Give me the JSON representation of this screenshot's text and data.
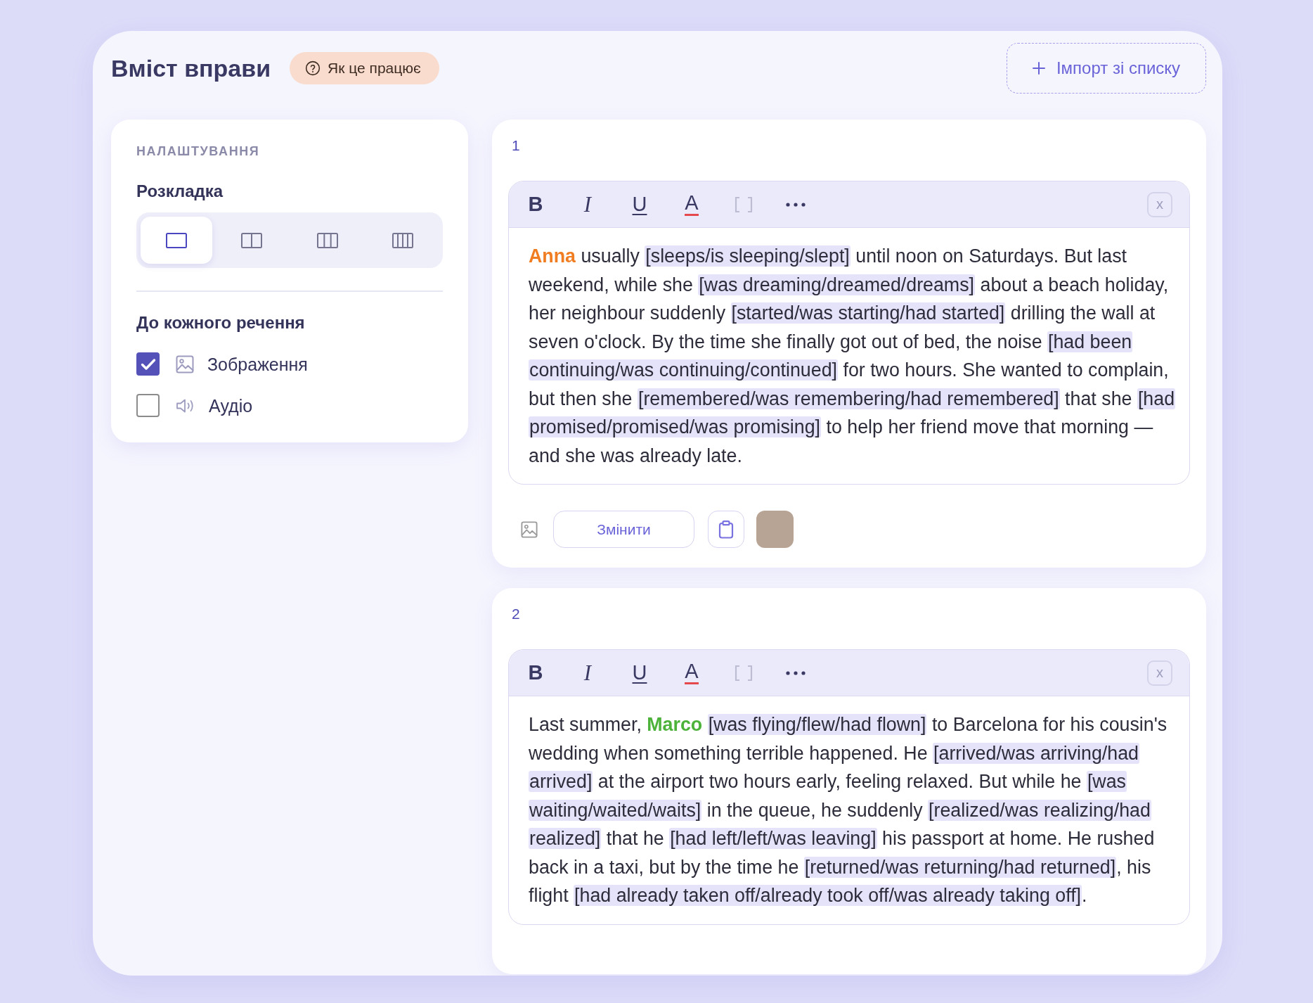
{
  "header": {
    "title": "Вміст вправи",
    "help_label": "Як це працює",
    "import_label": "Імпорт зі списку"
  },
  "settings": {
    "heading": "НАЛАШТУВАННЯ",
    "layout_label": "Розкладка",
    "layout_options": [
      {
        "kind": "one",
        "selected": true
      },
      {
        "kind": "two",
        "selected": false
      },
      {
        "kind": "three",
        "selected": false
      },
      {
        "kind": "four",
        "selected": false
      }
    ],
    "per_sentence_label": "До кожного речення",
    "attachments": [
      {
        "kind": "image",
        "label": "Зображення",
        "checked": true
      },
      {
        "kind": "audio",
        "label": "Аудіо",
        "checked": false
      }
    ]
  },
  "exercises": [
    {
      "number": "1",
      "toolbar": [
        {
          "kind": "bold",
          "label": "B",
          "disabled": false
        },
        {
          "kind": "italic",
          "label": "I",
          "disabled": false
        },
        {
          "kind": "underline",
          "label": "U",
          "disabled": false
        },
        {
          "kind": "color",
          "label": "A",
          "disabled": false
        },
        {
          "kind": "brackets",
          "disabled": true
        },
        {
          "kind": "more",
          "disabled": false
        }
      ],
      "close_label": "x",
      "text": [
        {
          "kind": "name",
          "text": "Anna",
          "color": "#f07d22"
        },
        {
          "kind": "plain",
          "text": " usually "
        },
        {
          "kind": "blank",
          "text": "[sleeps/is sleeping/slept]"
        },
        {
          "kind": "plain",
          "text": " until noon on Saturdays. But last weekend, while she "
        },
        {
          "kind": "blank",
          "text": "[was dreaming/dreamed/dreams]"
        },
        {
          "kind": "plain",
          "text": " about a beach holiday, her neighbour suddenly "
        },
        {
          "kind": "blank",
          "text": "[started/was starting/had started]"
        },
        {
          "kind": "plain",
          "text": " drilling the wall at seven o'clock. By the time she finally got out of bed, the noise "
        },
        {
          "kind": "blank",
          "text": "[had been continuing/was continuing/continued]"
        },
        {
          "kind": "plain",
          "text": " for two hours. She wanted to complain, but then she "
        },
        {
          "kind": "blank",
          "text": "[remembered/was remembering/had remembered]"
        },
        {
          "kind": "plain",
          "text": " that she "
        },
        {
          "kind": "blank",
          "text": "[had promised/promised/was promising]"
        },
        {
          "kind": "plain",
          "text": " to help her friend move that morning — and she was already late."
        }
      ],
      "media": {
        "change_label": "Змінити"
      }
    },
    {
      "number": "2",
      "toolbar": [
        {
          "kind": "bold",
          "label": "B",
          "disabled": false
        },
        {
          "kind": "italic",
          "label": "I",
          "disabled": false
        },
        {
          "kind": "underline",
          "label": "U",
          "disabled": false
        },
        {
          "kind": "color",
          "label": "A",
          "disabled": false
        },
        {
          "kind": "brackets",
          "disabled": true
        },
        {
          "kind": "more",
          "disabled": false
        }
      ],
      "close_label": "x",
      "text": [
        {
          "kind": "plain",
          "text": "Last summer, "
        },
        {
          "kind": "name",
          "text": "Marco",
          "color": "#4cb23a",
          "space_after": true
        },
        {
          "kind": "blank",
          "text": "[was flying/flew/had flown]"
        },
        {
          "kind": "plain",
          "text": " to Barcelona for his cousin's wedding when something terrible happened. He "
        },
        {
          "kind": "blank",
          "text": "[arrived/was arriving/had arrived]"
        },
        {
          "kind": "plain",
          "text": " at the airport two hours early, feeling relaxed. But while he "
        },
        {
          "kind": "blank",
          "text": "[was waiting/waited/waits]"
        },
        {
          "kind": "plain",
          "text": " in the queue, he suddenly "
        },
        {
          "kind": "blank",
          "text": "[realized/was realizing/had realized]"
        },
        {
          "kind": "plain",
          "text": " that he "
        },
        {
          "kind": "blank",
          "text": "[had left/left/was leaving]"
        },
        {
          "kind": "plain",
          "text": " his passport at home. He rushed back in a taxi, but by the time he "
        },
        {
          "kind": "blank",
          "text": "[returned/was returning/had returned]"
        },
        {
          "kind": "plain",
          "text": ", his flight "
        },
        {
          "kind": "blank",
          "text": "[had already taken off/already took off/was already taking off]"
        },
        {
          "kind": "plain",
          "text": "."
        }
      ]
    }
  ]
}
